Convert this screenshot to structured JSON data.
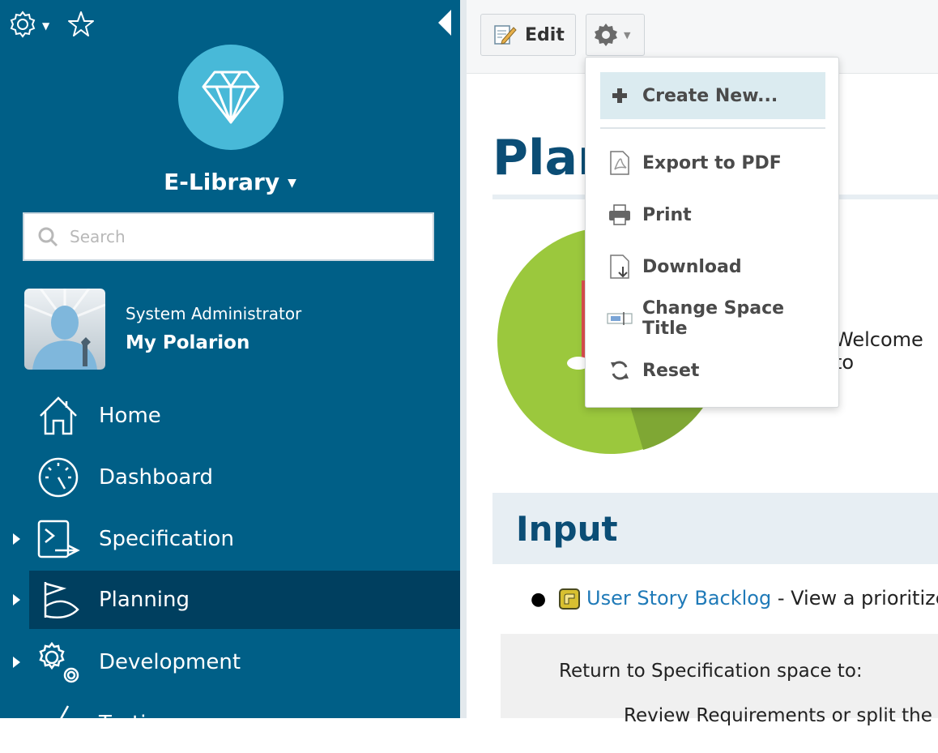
{
  "sidebar": {
    "project_name": "E-Library",
    "search_placeholder": "Search",
    "user": {
      "name": "System Administrator",
      "link": "My Polarion"
    },
    "nav": [
      {
        "label": "Home"
      },
      {
        "label": "Dashboard"
      },
      {
        "label": "Specification"
      },
      {
        "label": "Planning"
      },
      {
        "label": "Development"
      },
      {
        "label": "Testing"
      }
    ]
  },
  "toolbar": {
    "edit_label": "Edit"
  },
  "menu": {
    "items": [
      {
        "label": "Create New..."
      },
      {
        "label": "Export to PDF"
      },
      {
        "label": "Print"
      },
      {
        "label": "Download"
      },
      {
        "label": "Change Space Title"
      },
      {
        "label": "Reset"
      }
    ]
  },
  "content": {
    "title": "Plan",
    "welcome": "Welcome to",
    "input_heading": "Input",
    "backlog_link": "User Story Backlog",
    "backlog_rest": " - View a prioritize",
    "return_text": "Return to Specification space to:",
    "review_text": "Review Requirements or split the"
  },
  "colors": {
    "sidebar": "#005f87",
    "sidebar_active": "#003f5f",
    "logo": "#48b9d8",
    "heading": "#0b4d75",
    "link": "#1f7ab8",
    "pie": "#9bc83d"
  }
}
